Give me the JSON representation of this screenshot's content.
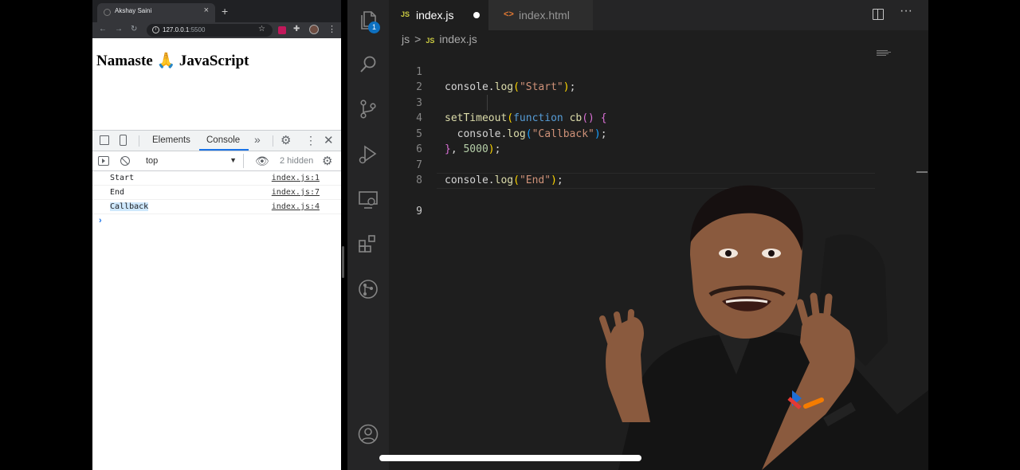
{
  "browser": {
    "tab_title": "Akshay Saini",
    "tab_close": "×",
    "new_tab": "+",
    "url_host": "127.0.0.1",
    "url_port": ":5500",
    "nav": {
      "back": "←",
      "forward": "→",
      "reload": "↻"
    },
    "page_heading": "Namaste 🙏 JavaScript"
  },
  "devtools": {
    "tabs": [
      "Elements",
      "Console"
    ],
    "active_tab": "Console",
    "more_tabs": "»",
    "context": "top",
    "hidden_count": "2 hidden",
    "console_messages": [
      {
        "text": "Start",
        "source": "index.js:1",
        "selected": false
      },
      {
        "text": "End",
        "source": "index.js:7",
        "selected": false
      },
      {
        "text": "Callback",
        "source": "index.js:4",
        "selected": true
      }
    ],
    "prompt": "›"
  },
  "vscode": {
    "files_badge": "1",
    "tabs": [
      {
        "badge": "JS",
        "label": "index.js",
        "active": true,
        "dirty": true
      },
      {
        "badge": "<>",
        "label": "index.html",
        "active": false,
        "dirty": false
      }
    ],
    "more_actions": "···",
    "breadcrumbs": {
      "folder": "js",
      "separator": ">",
      "badge": "JS",
      "file": "index.js"
    },
    "line_numbers": [
      "1",
      "2",
      "3",
      "4",
      "5",
      "6",
      "7",
      "8",
      "9"
    ],
    "active_line": "9",
    "code_lines": [
      "console.log(\"Start\");",
      "",
      "setTimeout(function cb() {",
      "  console.log(\"Callback\");",
      "}, 5000);",
      "",
      "console.log(\"End\");",
      "",
      ""
    ]
  },
  "colors": {
    "editor_bg": "#1e1e1e",
    "activity_bar_bg": "#252526",
    "accent_blue": "#1a73e8",
    "badge_blue": "#0e70c0",
    "js_badge": "#cbcb41",
    "html_icon": "#e37933",
    "string": "#ce9178",
    "function": "#dcdcaa",
    "keyword": "#569cd6",
    "number": "#b5cea8"
  },
  "icons": [
    "inspect-icon",
    "device-toolbar-icon",
    "settings-icon",
    "kebab-icon",
    "close-icon",
    "sidebar-toggle-icon",
    "clear-console-icon",
    "live-expression-icon",
    "files-icon",
    "search-icon",
    "source-control-icon",
    "run-debug-icon",
    "remote-explorer-icon",
    "extensions-icon",
    "git-graph-icon",
    "account-icon",
    "split-editor-icon"
  ]
}
